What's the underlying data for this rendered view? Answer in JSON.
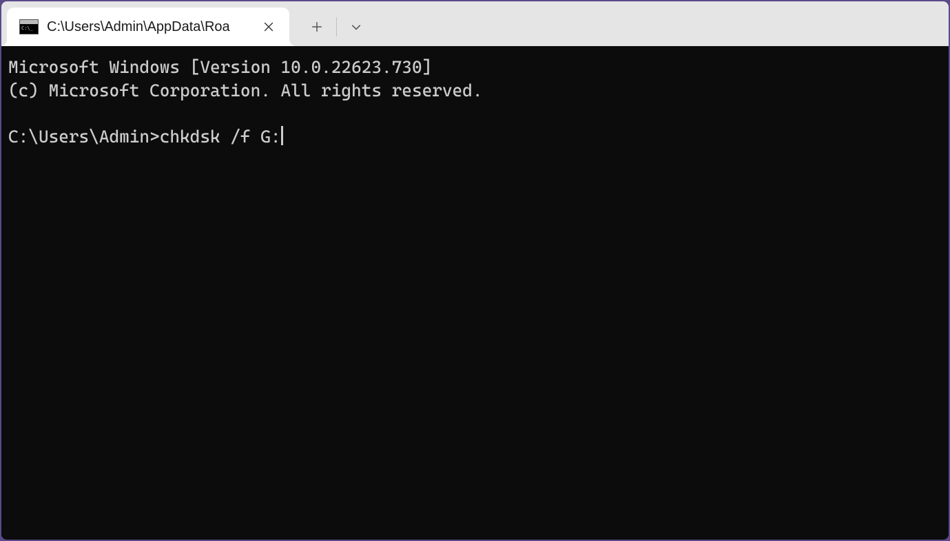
{
  "tab": {
    "icon_name": "cmd-icon",
    "title": "C:\\Users\\Admin\\AppData\\Roa"
  },
  "terminal": {
    "line1": "Microsoft Windows [Version 10.0.22623.730]",
    "line2": "(c) Microsoft Corporation. All rights reserved.",
    "blank": "",
    "prompt": "C:\\Users\\Admin>",
    "command": "chkdsk /f G:"
  },
  "colors": {
    "window_border": "#5a4a8a",
    "titlebar_bg": "#e5e5e5",
    "tab_bg": "#ffffff",
    "terminal_bg": "#0c0c0c",
    "terminal_fg": "#cccccc"
  }
}
